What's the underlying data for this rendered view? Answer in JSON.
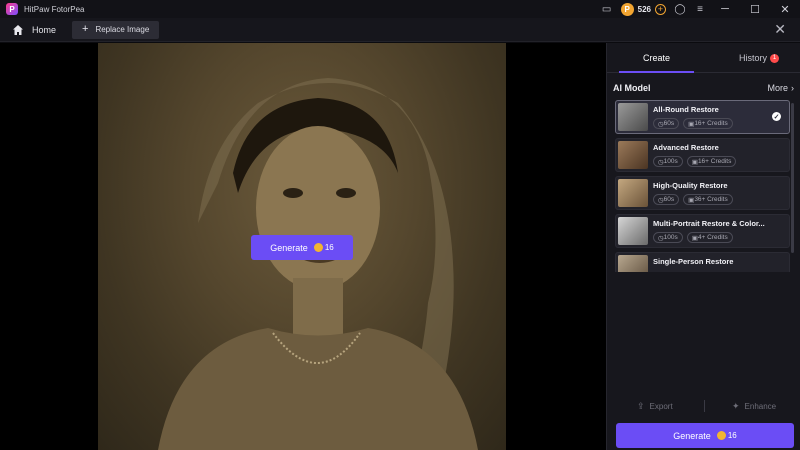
{
  "app": {
    "title": "HitPaw FotorPea",
    "logo_letter": "P",
    "credits": "526"
  },
  "toolbar": {
    "home_label": "Home",
    "replace_label": "Replace Image",
    "close_glyph": "✕"
  },
  "canvas": {
    "generate_label": "Generate",
    "generate_credits": "16"
  },
  "panel": {
    "tab_create": "Create",
    "tab_history": "History",
    "history_badge": "1",
    "section_title": "AI Model",
    "more_label": "More",
    "models": [
      {
        "name": "All-Round Restore",
        "time": "60s",
        "credits": "16+ Credits",
        "selected": true
      },
      {
        "name": "Advanced Restore",
        "time": "100s",
        "credits": "16+ Credits",
        "selected": false
      },
      {
        "name": "High-Quality Restore",
        "time": "60s",
        "credits": "36+ Credits",
        "selected": false
      },
      {
        "name": "Multi-Portrait Restore & Color...",
        "time": "100s",
        "credits": "4+ Credits",
        "selected": false
      },
      {
        "name": "Single-Person Restore",
        "time": "",
        "credits": "",
        "selected": false
      }
    ],
    "export_label": "Export",
    "enhance_label": "Enhance",
    "generate_label": "Generate",
    "generate_credits": "16"
  },
  "colors": {
    "accent": "#6b4df5",
    "coin": "#f2a531",
    "badge": "#ff4b4b",
    "sepia": "#54462d"
  }
}
